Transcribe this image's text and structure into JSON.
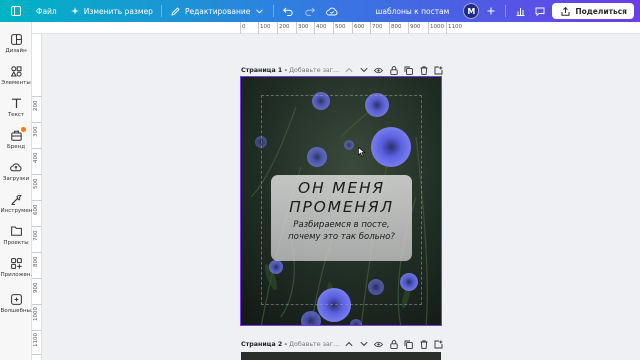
{
  "topbar": {
    "menu_icon": "sidebar-toggle-icon",
    "file_label": "Файл",
    "resize_label": "Изменить размер",
    "edit_label": "Редактирование",
    "undo_icon": "undo-icon",
    "redo_icon": "redo-icon",
    "cloud_icon": "cloud-save-icon",
    "project_title": "шаблоны к постам",
    "avatar_letter": "M",
    "share_label": "Поделиться"
  },
  "sidebar": {
    "items": [
      {
        "label": "Дизайн",
        "icon": "design-icon"
      },
      {
        "label": "Элементы",
        "icon": "elements-icon"
      },
      {
        "label": "Текст",
        "icon": "text-icon"
      },
      {
        "label": "Бренд",
        "icon": "brand-icon"
      },
      {
        "label": "Загрузки",
        "icon": "uploads-icon"
      },
      {
        "label": "Инструмен...",
        "icon": "tools-icon"
      },
      {
        "label": "Проекты",
        "icon": "projects-icon"
      },
      {
        "label": "Приложен...",
        "icon": "apps-icon"
      },
      {
        "label": "Волшебны...",
        "icon": "magic-icon"
      }
    ]
  },
  "ruler": {
    "top_ticks": [
      "0",
      "100",
      "200",
      "300",
      "400",
      "500",
      "600",
      "700",
      "800",
      "900",
      "1000",
      "1100"
    ],
    "left_ticks": [
      "200",
      "300",
      "400",
      "500",
      "600",
      "700",
      "800",
      "900",
      "1000",
      "1100",
      "1200",
      "1300",
      "1400"
    ]
  },
  "page1": {
    "title": "Страница 1 -",
    "subtitle": "Добавьте заг...",
    "card_title_line1": "ОН МЕНЯ",
    "card_title_line2": "ПРОМЕНЯЛ",
    "card_sub_line1": "Разбираемся в посте,",
    "card_sub_line2": "почему это так больно?"
  },
  "page2": {
    "title": "Страница 2 -",
    "subtitle": "Добавьте заг..."
  },
  "colors": {
    "accent": "#7b3fe4",
    "topbar_start": "#00b4c5",
    "topbar_end": "#6a3de8",
    "flower": "#5b63e6"
  }
}
